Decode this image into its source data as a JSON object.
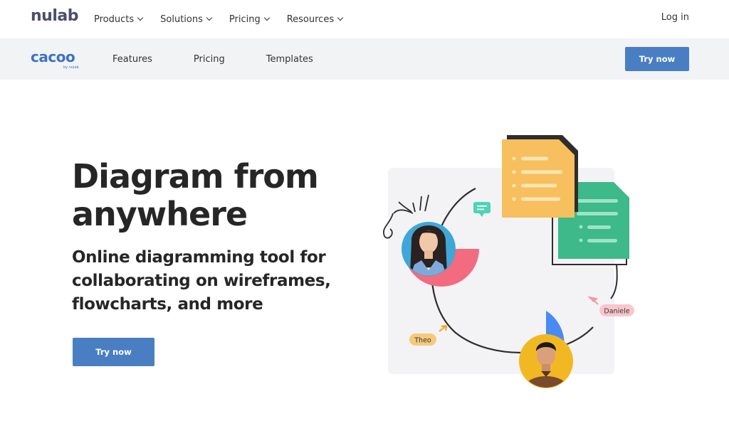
{
  "topnav": {
    "logo": "nulab",
    "menu": [
      {
        "label": "Products"
      },
      {
        "label": "Solutions"
      },
      {
        "label": "Pricing"
      },
      {
        "label": "Resources"
      }
    ],
    "login": "Log in"
  },
  "subnav": {
    "logo": "cacoo",
    "logo_by": "by nulab",
    "links": [
      {
        "label": "Features"
      },
      {
        "label": "Pricing"
      },
      {
        "label": "Templates"
      }
    ],
    "cta": "Try now"
  },
  "hero": {
    "title_line1": "Diagram from",
    "title_line2": "anywhere",
    "subtitle": "Online diagramming tool for collaborating on wireframes, flowcharts, and more",
    "cta": "Try now"
  },
  "illustration": {
    "tag_daniele": "Daniele",
    "tag_theo": "Theo",
    "colors": {
      "doc_yellow": "#f7bf5e",
      "doc_green": "#3db98a",
      "arc_pink": "#f26b7e",
      "arc_blue": "#4a8af4",
      "chat_teal": "#4fd3b6",
      "avatar1_bg": "#3fa7d8",
      "avatar2_bg": "#f2b824"
    }
  }
}
